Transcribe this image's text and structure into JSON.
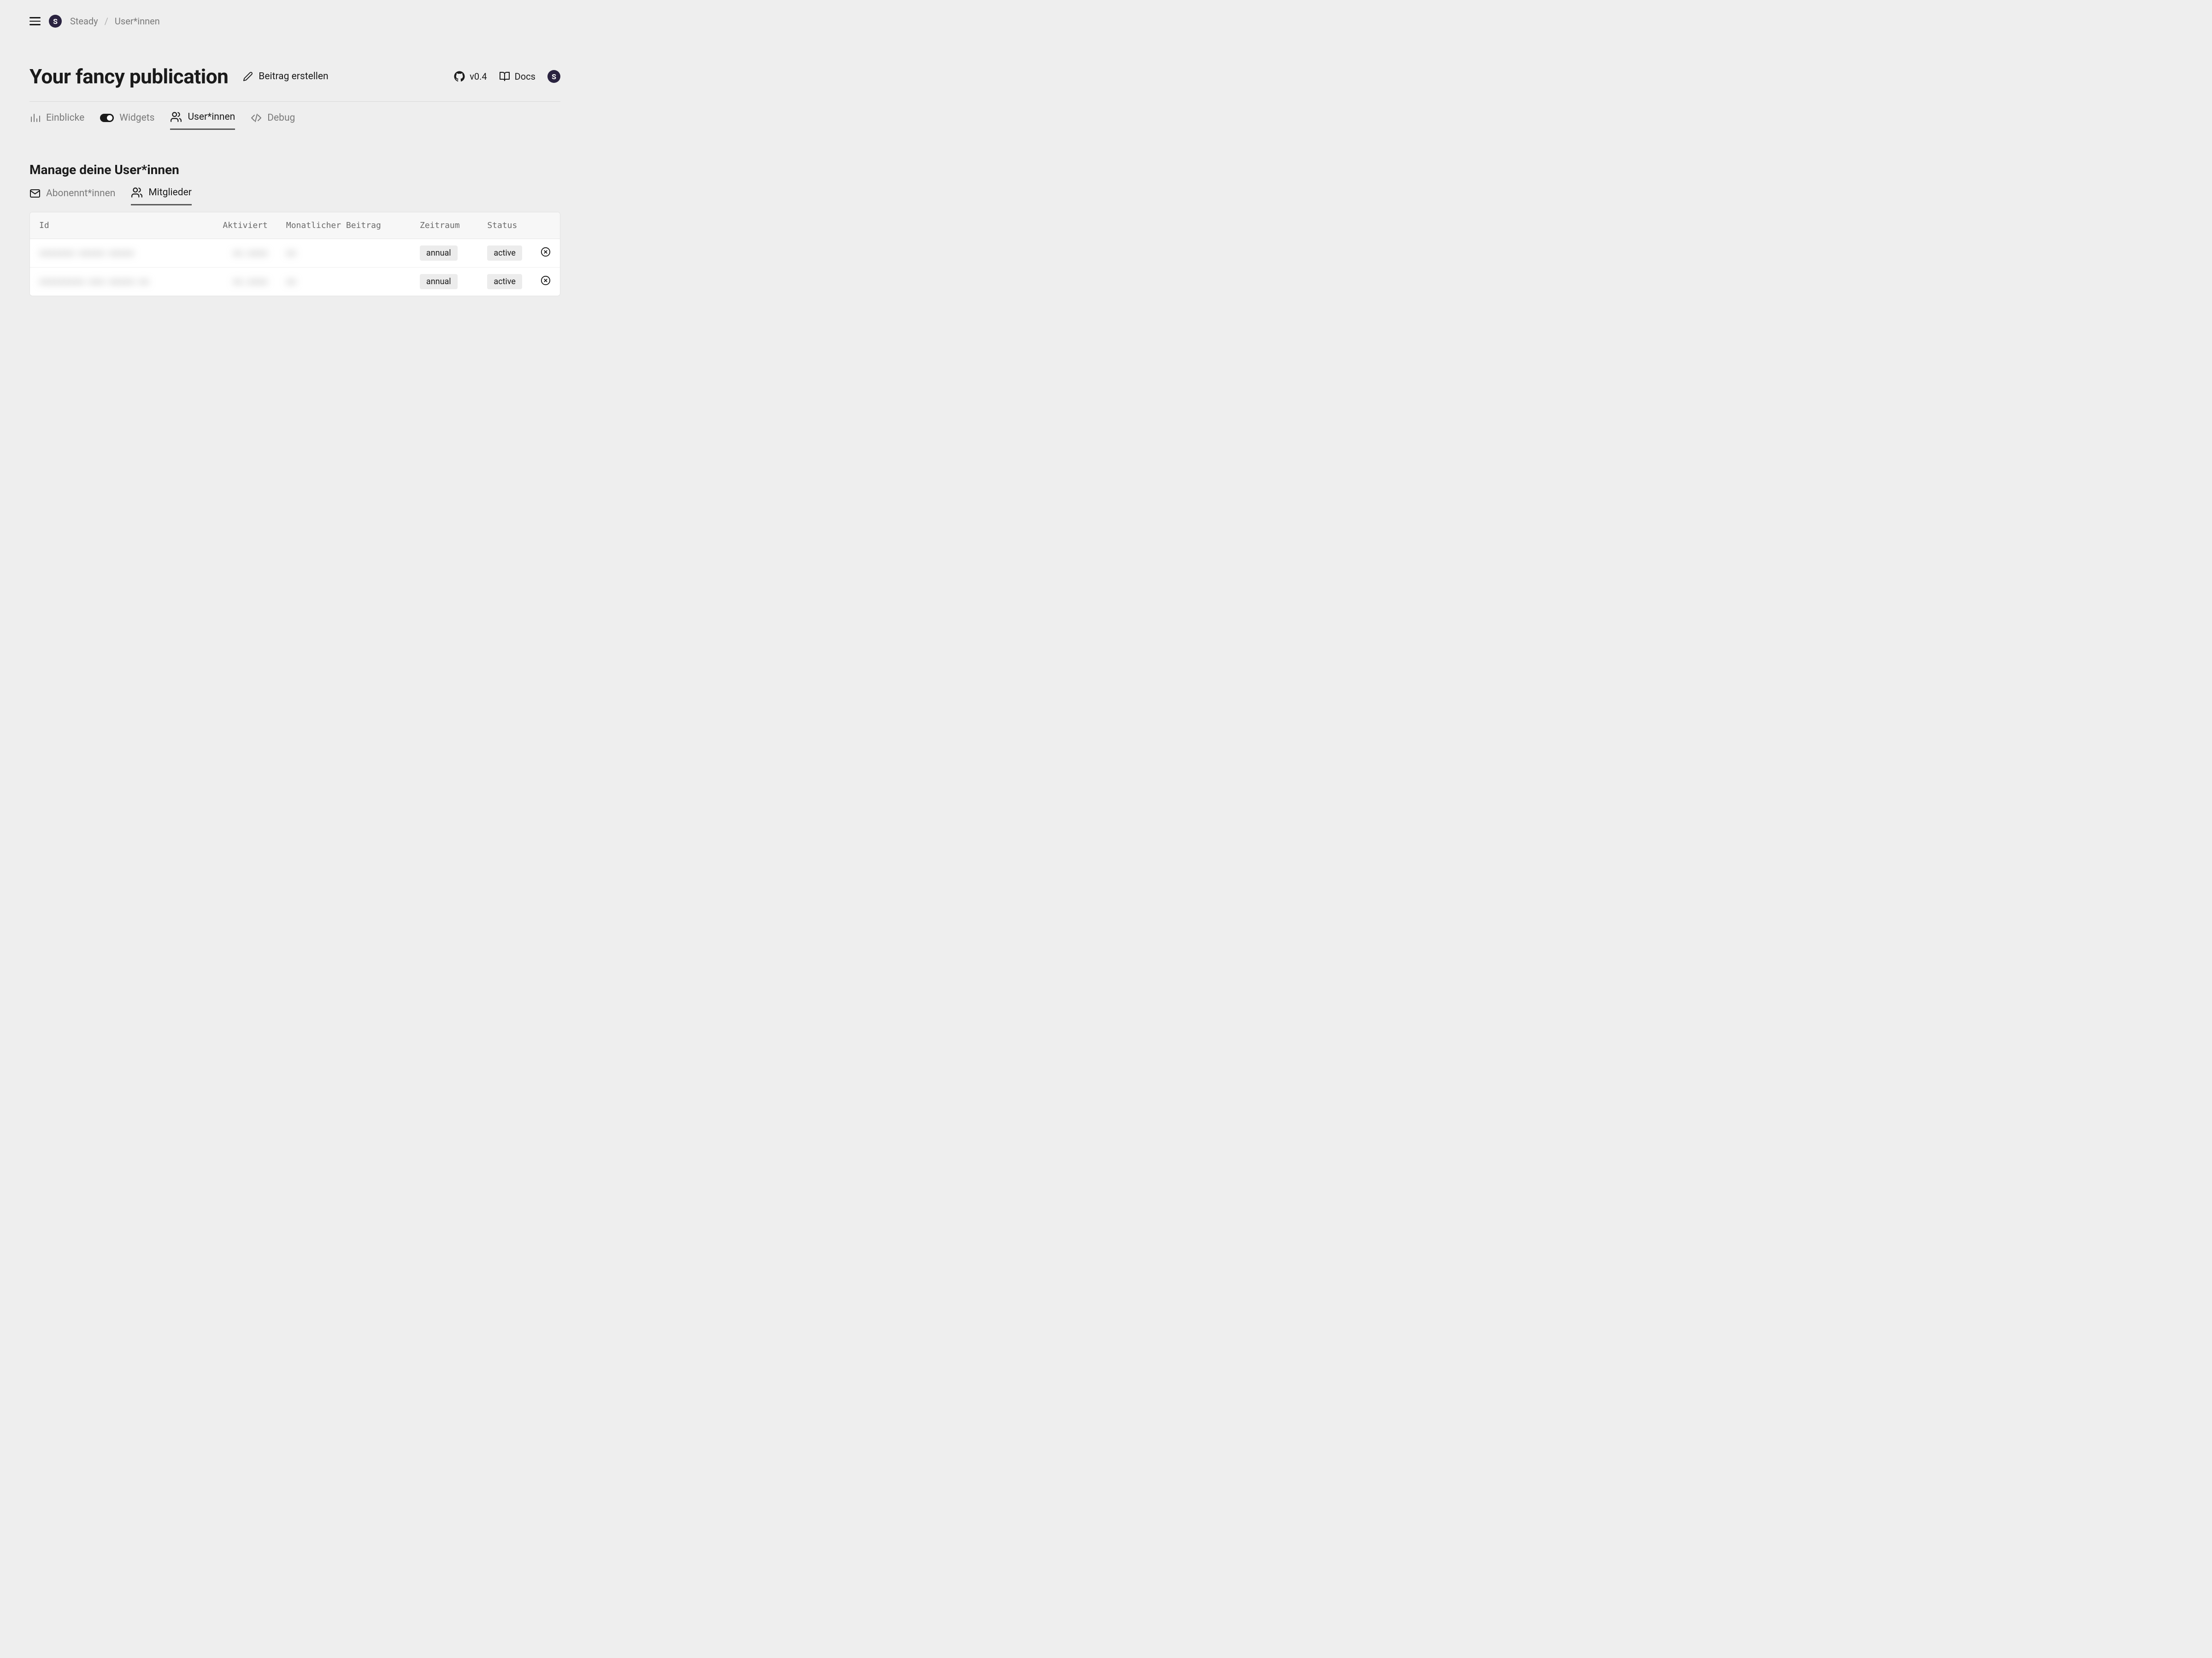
{
  "breadcrumb": {
    "root": "Steady",
    "current": "User*innen"
  },
  "header": {
    "title": "Your fancy publication",
    "create_label": "Beitrag erstellen",
    "version": "v0.4",
    "docs_label": "Docs"
  },
  "tabs": {
    "einblicke": "Einblicke",
    "widgets": "Widgets",
    "userinnen": "User*innen",
    "debug": "Debug"
  },
  "section": {
    "title": "Manage deine User*innen"
  },
  "subtabs": {
    "abonnentinnen": "Abonennt*innen",
    "mitglieder": "Mitglieder"
  },
  "table": {
    "columns": {
      "id": "Id",
      "aktiviert": "Aktiviert",
      "monatlicher_beitrag": "Monatlicher Beitrag",
      "zeitraum": "Zeitraum",
      "status": "Status"
    },
    "rows": [
      {
        "id": "xxxxxxx-xxxxx-xxxxx",
        "aktiviert": "xx.xxxx",
        "monatlicher_beitrag": "xx",
        "zeitraum": "annual",
        "status": "active"
      },
      {
        "id": "xxxxxxxxx-xxx-xxxxx-xx",
        "aktiviert": "xx.xxxx",
        "monatlicher_beitrag": "xx",
        "zeitraum": "annual",
        "status": "active"
      }
    ]
  }
}
